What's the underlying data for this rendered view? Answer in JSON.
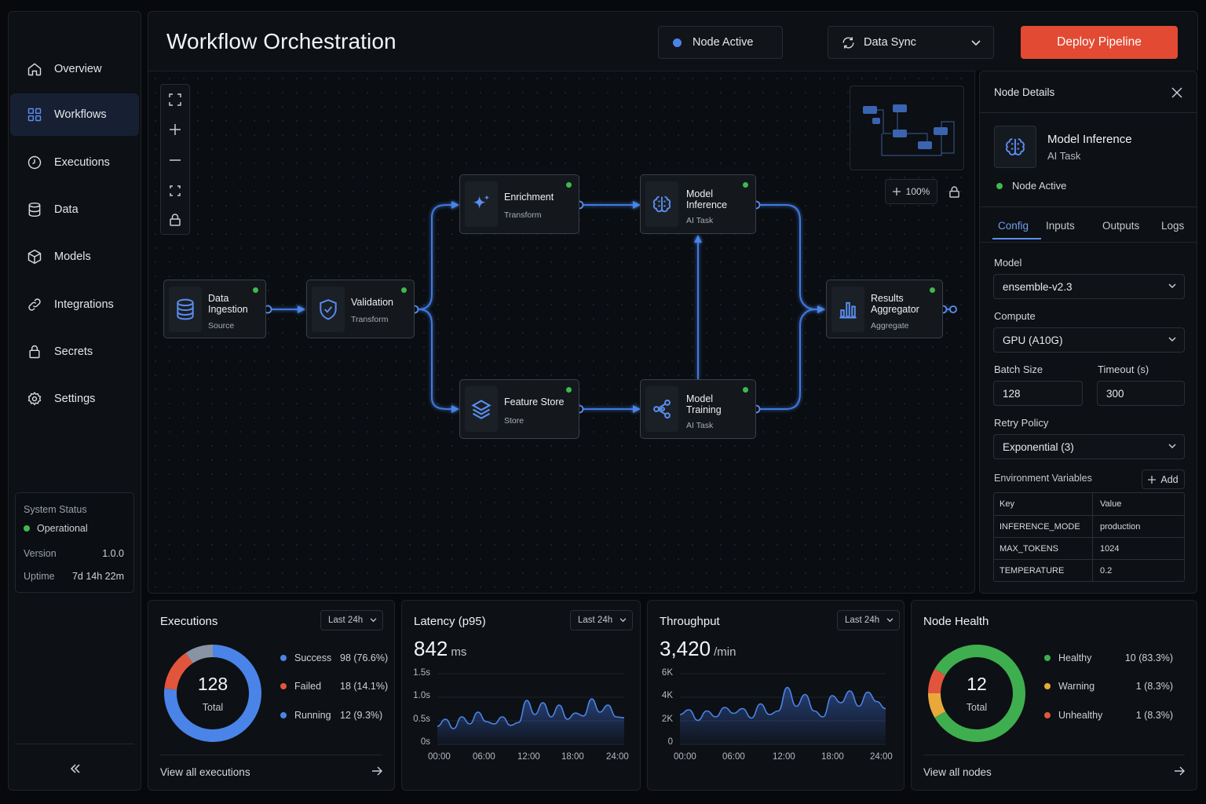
{
  "sidebar": {
    "items": [
      {
        "label": "Overview",
        "icon": "home-icon"
      },
      {
        "label": "Workflows",
        "icon": "grid-icon",
        "active": true
      },
      {
        "label": "Executions",
        "icon": "clock-icon"
      },
      {
        "label": "Data",
        "icon": "database-icon"
      },
      {
        "label": "Models",
        "icon": "cube-icon"
      },
      {
        "label": "Integrations",
        "icon": "link-icon"
      },
      {
        "label": "Secrets",
        "icon": "lock-icon"
      },
      {
        "label": "Settings",
        "icon": "gear-icon"
      }
    ],
    "status": {
      "title": "System Status",
      "state": "Operational",
      "version_label": "Version",
      "version": "1.0.0",
      "uptime_label": "Uptime",
      "uptime": "7d 14h 22m"
    }
  },
  "header": {
    "title": "Workflow Orchestration",
    "node_status": "Node Active",
    "sync_select": "Data Sync",
    "deploy_label": "Deploy Pipeline"
  },
  "canvas": {
    "zoom": "100%",
    "nodes": [
      {
        "id": "data-ingestion",
        "title": "Data\nIngestion",
        "type": "Source",
        "icon": "database-icon"
      },
      {
        "id": "validation",
        "title": "Validation",
        "type": "Transform",
        "icon": "shield-check-icon"
      },
      {
        "id": "enrichment",
        "title": "Enrichment",
        "type": "Transform",
        "icon": "sparkle-icon"
      },
      {
        "id": "feature-store",
        "title": "Feature Store",
        "type": "Store",
        "icon": "layers-icon"
      },
      {
        "id": "model-inference",
        "title": "Model\nInference",
        "type": "AI Task",
        "icon": "brain-icon"
      },
      {
        "id": "model-training",
        "title": "Model\nTraining",
        "type": "AI Task",
        "icon": "share-graph-icon"
      },
      {
        "id": "results-aggregator",
        "title": "Results\nAggregator",
        "type": "Aggregate",
        "icon": "bar-chart-icon"
      }
    ]
  },
  "details": {
    "heading": "Node Details",
    "node_name": "Model Inference",
    "node_type": "AI Task",
    "status": "Node Active",
    "tabs": [
      "Config",
      "Inputs",
      "Outputs",
      "Logs"
    ],
    "model_label": "Model",
    "model": "ensemble-v2.3",
    "compute_label": "Compute",
    "compute": "GPU (A10G)",
    "batch_label": "Batch Size",
    "batch": "128",
    "timeout_label": "Timeout (s)",
    "timeout": "300",
    "retry_label": "Retry Policy",
    "retry": "Exponential (3)",
    "env_label": "Environment Variables",
    "add_label": "Add",
    "env_headers": [
      "Key",
      "Value"
    ],
    "env_rows": [
      [
        "INFERENCE_MODE",
        "production"
      ],
      [
        "MAX_TOKENS",
        "1024"
      ],
      [
        "TEMPERATURE",
        "0.2"
      ]
    ]
  },
  "cards": {
    "executions": {
      "title": "Executions",
      "range": "Last 24h",
      "total": "128",
      "total_label": "Total",
      "legend": [
        {
          "label": "Success",
          "value": "98 (76.6%)",
          "color": "#4a84e8"
        },
        {
          "label": "Failed",
          "value": "18 (14.1%)",
          "color": "#e2553d"
        },
        {
          "label": "Running",
          "value": "12 (9.3%)",
          "color": "#4a84e8"
        }
      ],
      "footer": "View all executions"
    },
    "latency": {
      "title": "Latency (p95)",
      "range": "Last 24h",
      "value": "842",
      "unit": "ms",
      "yticks": [
        "1.5s",
        "1.0s",
        "0.5s",
        "0s"
      ],
      "xticks": [
        "00:00",
        "06:00",
        "12:00",
        "18:00",
        "24:00"
      ]
    },
    "throughput": {
      "title": "Throughput",
      "range": "Last 24h",
      "value": "3,420",
      "unit": "/min",
      "yticks": [
        "6K",
        "4K",
        "2K",
        "0"
      ],
      "xticks": [
        "00:00",
        "06:00",
        "12:00",
        "18:00",
        "24:00"
      ]
    },
    "health": {
      "title": "Node Health",
      "total": "12",
      "total_label": "Total",
      "legend": [
        {
          "label": "Healthy",
          "value": "10 (83.3%)",
          "color": "#3fae4f"
        },
        {
          "label": "Warning",
          "value": "1 (8.3%)",
          "color": "#e8a93a"
        },
        {
          "label": "Unhealthy",
          "value": "1 (8.3%)",
          "color": "#e2553d"
        }
      ],
      "footer": "View all nodes"
    }
  },
  "chart_data": [
    {
      "type": "pie",
      "title": "Executions",
      "categories": [
        "Success",
        "Failed",
        "Running"
      ],
      "values": [
        98,
        18,
        12
      ]
    },
    {
      "type": "area",
      "title": "Latency (p95)",
      "ylim": [
        0,
        1.5
      ],
      "x": [
        "00:00",
        "06:00",
        "12:00",
        "18:00",
        "24:00"
      ],
      "values": [
        0.4,
        0.55,
        0.35,
        0.6,
        0.45,
        0.7,
        0.5,
        0.45,
        0.6,
        0.42,
        0.48,
        0.95,
        0.65,
        0.9,
        0.6,
        0.85,
        0.55,
        0.68,
        0.62,
        0.98,
        0.7,
        0.85,
        0.6,
        0.58
      ]
    },
    {
      "type": "area",
      "title": "Throughput",
      "ylim": [
        0,
        6000
      ],
      "x": [
        "00:00",
        "06:00",
        "12:00",
        "18:00",
        "24:00"
      ],
      "values": [
        2600,
        3000,
        2100,
        2900,
        2400,
        3200,
        2700,
        3100,
        2300,
        3500,
        2600,
        2900,
        4900,
        3300,
        4300,
        2900,
        2400,
        4200,
        3600,
        4600,
        3300,
        4500,
        3700,
        3100
      ]
    },
    {
      "type": "pie",
      "title": "Node Health",
      "categories": [
        "Healthy",
        "Warning",
        "Unhealthy"
      ],
      "values": [
        10,
        1,
        1
      ]
    }
  ]
}
